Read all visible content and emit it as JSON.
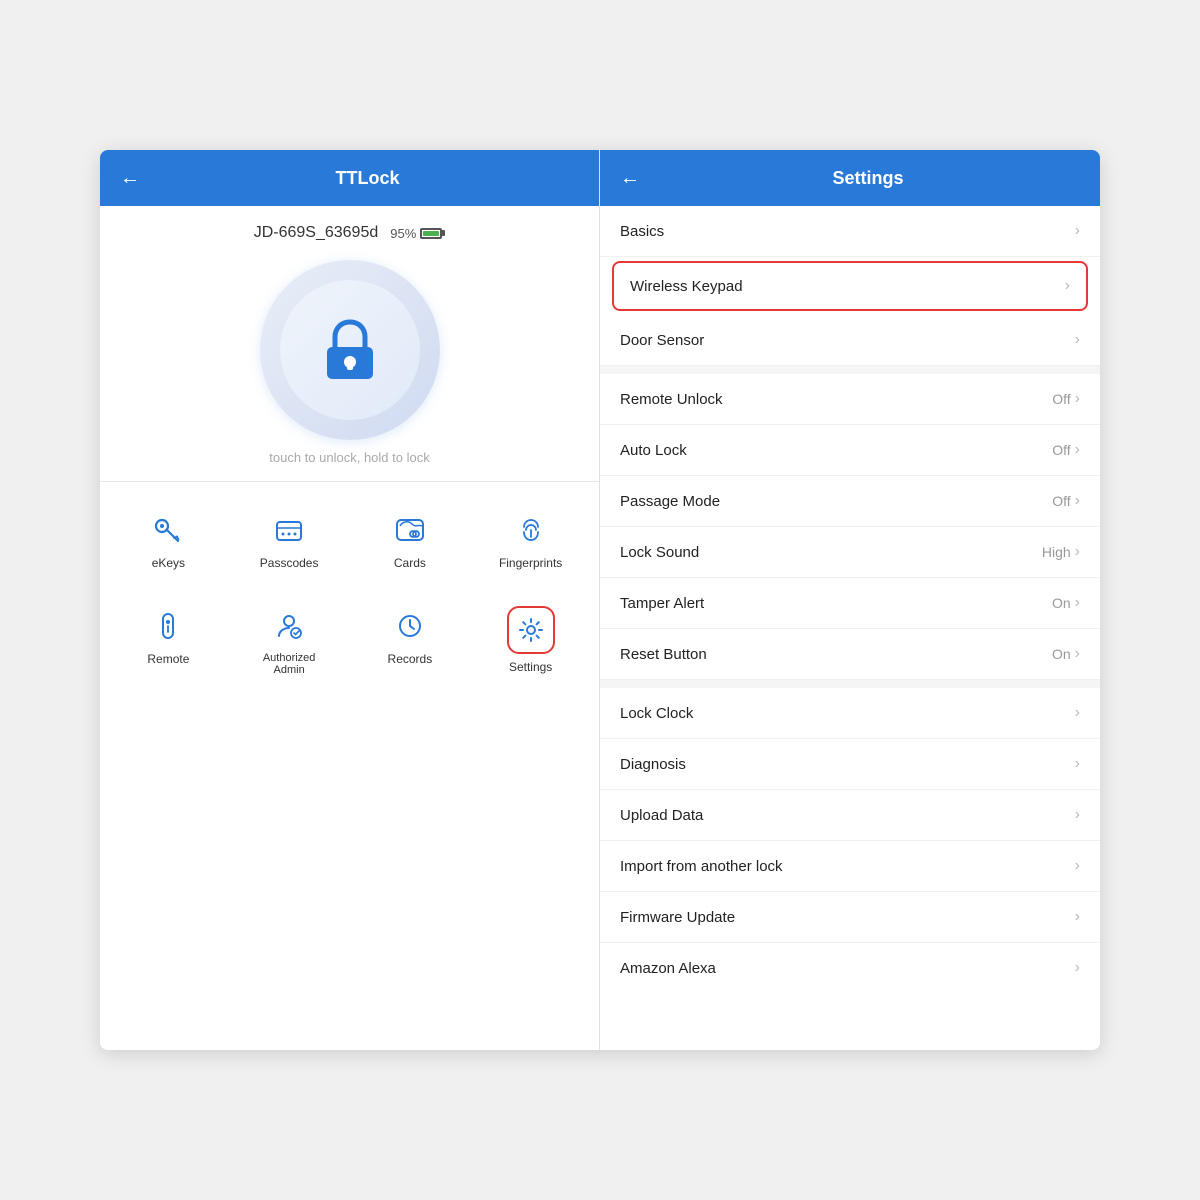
{
  "left_panel": {
    "header": {
      "back_label": "←",
      "title": "TTLock"
    },
    "device_id": "JD-669S_63695d",
    "battery_pct": "95%",
    "unlock_hint": "touch to unlock, hold to lock",
    "grid_row1": [
      {
        "id": "ekeys",
        "label": "eKeys"
      },
      {
        "id": "passcodes",
        "label": "Passcodes"
      },
      {
        "id": "cards",
        "label": "Cards"
      },
      {
        "id": "fingerprints",
        "label": "Fingerprints"
      }
    ],
    "grid_row2": [
      {
        "id": "remote",
        "label": "Remote"
      },
      {
        "id": "authorized-admin",
        "label": "Authorized Admin"
      },
      {
        "id": "records",
        "label": "Records"
      },
      {
        "id": "settings",
        "label": "Settings",
        "active": true
      }
    ]
  },
  "right_panel": {
    "header": {
      "back_label": "←",
      "title": "Settings"
    },
    "items": [
      {
        "id": "basics",
        "label": "Basics",
        "value": "",
        "highlighted": false
      },
      {
        "id": "wireless-keypad",
        "label": "Wireless Keypad",
        "value": "",
        "highlighted": true
      },
      {
        "id": "door-sensor",
        "label": "Door Sensor",
        "value": "",
        "highlighted": false
      },
      {
        "id": "divider1",
        "type": "gap"
      },
      {
        "id": "remote-unlock",
        "label": "Remote Unlock",
        "value": "Off",
        "highlighted": false
      },
      {
        "id": "auto-lock",
        "label": "Auto Lock",
        "value": "Off",
        "highlighted": false
      },
      {
        "id": "passage-mode",
        "label": "Passage Mode",
        "value": "Off",
        "highlighted": false
      },
      {
        "id": "lock-sound",
        "label": "Lock Sound",
        "value": "High",
        "highlighted": false
      },
      {
        "id": "tamper-alert",
        "label": "Tamper Alert",
        "value": "On",
        "highlighted": false
      },
      {
        "id": "reset-button",
        "label": "Reset Button",
        "value": "On",
        "highlighted": false
      },
      {
        "id": "divider2",
        "type": "gap"
      },
      {
        "id": "lock-clock",
        "label": "Lock Clock",
        "value": "",
        "highlighted": false
      },
      {
        "id": "diagnosis",
        "label": "Diagnosis",
        "value": "",
        "highlighted": false
      },
      {
        "id": "upload-data",
        "label": "Upload Data",
        "value": "",
        "highlighted": false
      },
      {
        "id": "import-from-another-lock",
        "label": "Import from another lock",
        "value": "",
        "highlighted": false
      },
      {
        "id": "firmware-update",
        "label": "Firmware Update",
        "value": "",
        "highlighted": false
      },
      {
        "id": "amazon-alexa",
        "label": "Amazon Alexa",
        "value": "",
        "highlighted": false
      }
    ]
  }
}
